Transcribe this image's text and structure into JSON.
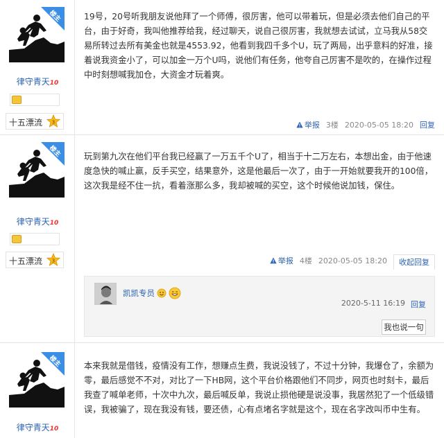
{
  "lz_badge": "楼主",
  "posts": [
    {
      "username": "律守青天",
      "user_tag": "10",
      "rank_name": "十五漂流",
      "rank_level": "3",
      "content": "19号，20号听我朋友说他拜了一个师傅，很厉害，他可以带着玩，但是必须去他们自己的平台，由于好奇，我叫他推荐给我，经过聊天，说自己很厉害，我就想去试试，立马我从58交易所转过去所有美金也就是4553.92，他看到我四千多个U，玩了两局，出乎意料的好准，接着说我资金小了，可以加金一万个U吗，说他们有任务，他夸自己厉害不是吹的，在操作过程中时刻想喊我加仓，大资金才玩着爽。",
      "report": "举报",
      "floor": "3楼",
      "time": "2020-05-05 18:20",
      "reply": "回复"
    },
    {
      "username": "律守青天",
      "user_tag": "10",
      "rank_name": "十五漂流",
      "rank_level": "3",
      "content": "玩到第九次在他们平台我已经赢了一万五千个U了，相当于十二万左右，本想出金，由于他速度急快的喊止赢，反手买空，结果意外，这是他最后一次了，由于一开始就要我开的100倍，这次我是经不住一抗，看着涨那么多，我却被喊的买空，这个时候他说加钱，保住。",
      "report": "举报",
      "floor": "4楼",
      "time": "2020-05-05 18:20",
      "collapse": "收起回复",
      "comment": {
        "username": "凯凯专员",
        "time": "2020-5-11 16:19",
        "reply": "回复",
        "say_button": "我也说一句"
      }
    },
    {
      "username": "律守青天",
      "user_tag": "10",
      "content": "本来我就是借钱，疫情没有工作，想赚点生费，我说没钱了，不过十分钟，我爆仓了，余额为零，最后感觉不不对，对比了一下HB网，这个平台价格跟他们不同步，网页也时刻卡，最后我查了喊单老师，十次中九次，最后喊反单，我说止损他硬是说没事，我居然犯了一个低级错误，我被骗了，现在我没有钱，要还债，心有点堵名字就是这个，现在名字改叫币中生有。"
    }
  ]
}
